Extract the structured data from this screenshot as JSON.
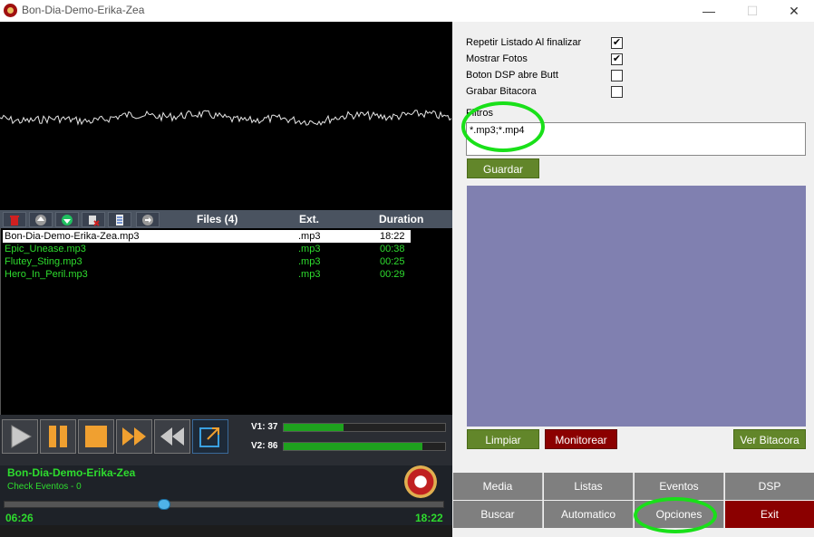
{
  "window": {
    "title": "Bon-Dia-Demo-Erika-Zea",
    "minimize": "—",
    "maximize": "☐",
    "close": "✕"
  },
  "files": {
    "header": "Files (4)",
    "ext_header": "Ext.",
    "duration_header": "Duration",
    "rows": [
      {
        "name": "Bon-Dia-Demo-Erika-Zea.mp3",
        "ext": ".mp3",
        "duration": "18:22"
      },
      {
        "name": "Epic_Unease.mp3",
        "ext": ".mp3",
        "duration": "00:38"
      },
      {
        "name": "Flutey_Sting.mp3",
        "ext": ".mp3",
        "duration": "00:25"
      },
      {
        "name": "Hero_In_Peril.mp3",
        "ext": ".mp3",
        "duration": "00:29"
      }
    ]
  },
  "meters": {
    "v1_label": "V1: 37",
    "v1_level": 0.37,
    "v2_label": "V2: 86",
    "v2_level": 0.86
  },
  "now_playing": {
    "title": "Bon-Dia-Demo-Erika-Zea",
    "subtitle": "Check Eventos - 0",
    "elapsed": "06:26",
    "total": "18:22",
    "progress": 0.35
  },
  "options": {
    "repeat_label": "Repetir Listado Al finalizar",
    "repeat_checked": true,
    "photos_label": "Mostrar Fotos",
    "photos_checked": true,
    "dsp_label": "Boton DSP abre Butt",
    "dsp_checked": false,
    "log_label": "Grabar Bitacora",
    "log_checked": false,
    "filter_label": "Filtros",
    "filter_value": "*.mp3;*.mp4",
    "save_button": "Guardar"
  },
  "log_buttons": {
    "clear": "Limpiar",
    "monitor": "Monitorear",
    "view": "Ver Bitacora"
  },
  "nav": {
    "media": "Media",
    "lists": "Listas",
    "events": "Eventos",
    "dsp": "DSP",
    "search": "Buscar",
    "automatic": "Automatico",
    "options": "Opciones",
    "exit": "Exit"
  },
  "colors": {
    "accent_green": "#2edc2e",
    "button_green": "#62862a",
    "button_red": "#8b0000",
    "log_panel": "#8080b0",
    "annotation": "#19e019"
  }
}
